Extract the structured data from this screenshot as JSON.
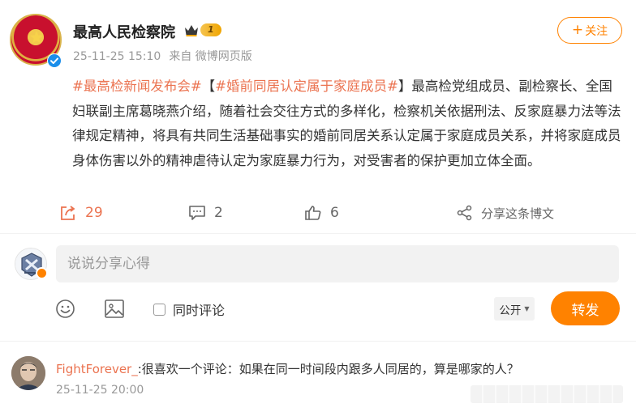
{
  "post": {
    "author": "最高人民检察院",
    "vip_level": "1",
    "timestamp": "25-11-25 15:10",
    "source": "来自 微博网页版",
    "follow_label": "关注",
    "tag1": "#最高检新闻发布会#",
    "tag2_open": "【",
    "tag2": "#婚前同居认定属于家庭成员#",
    "tag2_close": "】",
    "body": "最高检党组成员、副检察长、全国妇联副主席葛晓燕介绍，随着社会交往方式的多样化，检察机关依据刑法、反家庭暴力法等法律规定精神，将具有共同生活基础事实的婚前同居关系认定属于家庭成员关系，并将家庭成员身体伤害以外的精神虐待认定为家庭暴力行为，对受害者的保护更加立体全面。"
  },
  "actions": {
    "reposts": "29",
    "comments": "2",
    "likes": "6",
    "share_label": "分享这条博文"
  },
  "composer": {
    "placeholder": "说说分享心得",
    "also_comment_label": "同时评论",
    "visibility": "公开",
    "submit_label": "转发"
  },
  "comments": [
    {
      "user": "FightForever_",
      "text": ":很喜欢一个评论：如果在同一时间段内跟多人同居的，算是哪家的人？",
      "time": "25-11-25 20:00"
    }
  ],
  "colors": {
    "accent": "#ff8200",
    "link": "#eb7350",
    "muted": "#999999"
  }
}
